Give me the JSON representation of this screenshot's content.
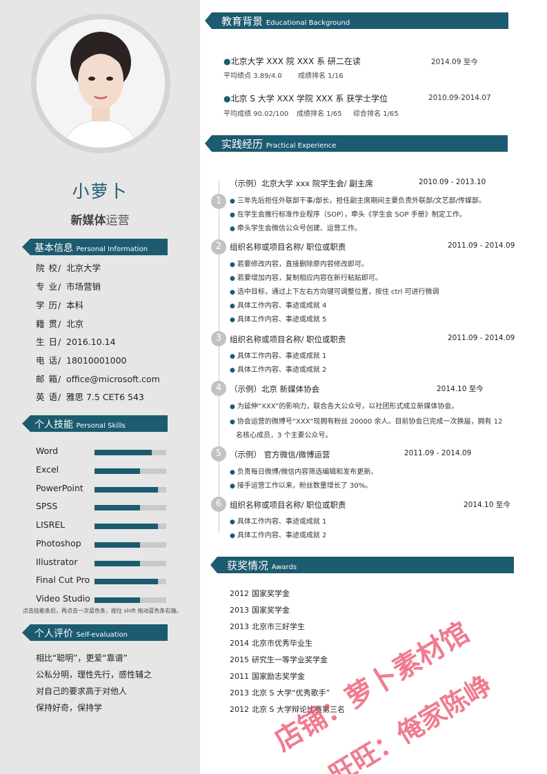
{
  "profile": {
    "name": "小萝卜",
    "job_bold": "新媒体",
    "job_rest": "运营"
  },
  "basic": {
    "title": "基本信息",
    "title_en": "Personal Information",
    "rows": [
      {
        "label": "院 校/",
        "value": "北京大学"
      },
      {
        "label": "专 业/",
        "value": "市场营销"
      },
      {
        "label": "学 历/",
        "value": "本科"
      },
      {
        "label": "籍 贯/",
        "value": "北京"
      },
      {
        "label": "生 日/",
        "value": "2016.10.14"
      },
      {
        "label": "电 话/",
        "value": "18010001000"
      },
      {
        "label": "邮 箱/",
        "value": "office@microsoft.com"
      },
      {
        "label": "英 语/",
        "value": "雅思  7.5    CET6 543"
      }
    ]
  },
  "skills": {
    "title": "个人技能",
    "title_en": "Personal Skills",
    "items": [
      {
        "name": "Word",
        "level": 0.8
      },
      {
        "name": "Excel",
        "level": 0.63
      },
      {
        "name": "PowerPoint",
        "level": 0.88
      },
      {
        "name": "SPSS",
        "level": 0.63
      },
      {
        "name": "LISREL",
        "level": 0.88
      },
      {
        "name": "Photoshop",
        "level": 0.63
      },
      {
        "name": "Illustrator",
        "level": 0.63
      },
      {
        "name": "Final Cut Pro",
        "level": 0.88
      },
      {
        "name": "Video Studio",
        "level": 0.63
      }
    ],
    "note": "点击技能条后，再点击一次蓝色条，按住 shift 拖动蓝色条右端。"
  },
  "evaluation": {
    "title": "个人评价",
    "title_en": "Self-evaluation",
    "lines": [
      "相比“聪明”，更爱“靠谱”",
      "公私分明，理性先行，感性辅之",
      "对自己的要求高于对他人",
      "保持好奇，保持学"
    ]
  },
  "education": {
    "title": "教育背景",
    "title_en": "Educational Background",
    "items": [
      {
        "title": "北京大学  XXX 院  XXX 系  研二在读",
        "date": "2014.09  至今",
        "sub": [
          "平均绩点  3.89/4.0",
          "成绩排名  1/16"
        ]
      },
      {
        "title": "北京 S 大学  XXX 学院  XXX 系  获学士学位",
        "date": "2010.09-2014.07",
        "sub": [
          "平均成绩  90.02/100",
          "成绩排名  1/65",
          "综合排名   1/65"
        ]
      }
    ]
  },
  "practice": {
    "title": "实践经历",
    "title_en": "Practical Experience",
    "items": [
      {
        "num": "1",
        "title": "（示例）北京大学  xxx 院学生会/  副主席",
        "date": "2010.09 - 2013.10",
        "bullets": [
          "三年先后担任外联部干事/部长，担任副主席期间主要负责外联部/文艺部/传媒部。",
          "在学生会推行标准作业程序（SOP），牵头《学生会 SOP 手册》制定工作。",
          "牵头学生会微信公众号创建、运营工作。"
        ]
      },
      {
        "num": "2",
        "title": "组织名称或项目名称/  职位或职责",
        "date": "2011.09 - 2014.09",
        "bullets": [
          "若要修改内容，直接删除原内容修改即可。",
          "若要增加内容，复制相应内容在新行粘贴即可。",
          "选中目标，通过上下左右方向键可调整位置，按住 ctrl 可进行微调",
          "具体工作内容、事迹或成就 4",
          "具体工作内容、事迹或成就 5"
        ]
      },
      {
        "num": "3",
        "title": "组织名称或项目名称/  职位或职责",
        "date": "2011.09 - 2014.09",
        "bullets": [
          "具体工作内容、事迹或成就 1",
          "具体工作内容、事迹或成就 2"
        ]
      },
      {
        "num": "4",
        "title": "（示例）北京  新媒体协会",
        "date": "2014.10  至今",
        "bullets": [
          "为延伸“XXX”的影响力，联合各大公众号，以社团形式成立新媒体协会。",
          "协会运营的微博号“XXX”现拥有粉丝 20000 余人。目前协会已完成一次换届，拥有 12"
        ],
        "cont": "名核心成员，3 个主要公众号。"
      },
      {
        "num": "5",
        "title": "（示例）  官方微信/微博运营",
        "date": "2011.09 - 2014.09",
        "bullets": [
          "负责每日微博/微信内容筛选编辑和发布更新。",
          "接手运营工作以来，粉丝数量增长了 30%。"
        ]
      },
      {
        "num": "6",
        "title": "组织名称或项目名称/  职位或职责",
        "date": "2014.10  至今",
        "bullets": [
          "具体工作内容、事迹或成就 1",
          "具体工作内容、事迹或成就 2"
        ]
      }
    ]
  },
  "awards": {
    "title": "获奖情况",
    "title_en": "Awards",
    "items": [
      {
        "year": "2012",
        "text": "国家奖学金"
      },
      {
        "year": "2013",
        "text": "国家奖学金"
      },
      {
        "year": "2013",
        "text": "北京市三好学生"
      },
      {
        "year": "2014",
        "text": "北京市优秀毕业生"
      },
      {
        "year": "2015",
        "text": "研究生一等学业奖学金"
      },
      {
        "year": "2011",
        "text": "国家励志奖学金"
      },
      {
        "year": "2013",
        "text": "北京 S 大学“优秀歌手”"
      },
      {
        "year": "2012",
        "text": "北京 S 大学辩论比赛第三名"
      }
    ]
  },
  "watermark": {
    "line1": "店铺：萝卜素材馆",
    "line2": "旺旺：俺家陈峥"
  },
  "colors": {
    "accent": "#1c5b70",
    "sidebar": "#e6e6e6",
    "watermark": "#ec4864"
  }
}
